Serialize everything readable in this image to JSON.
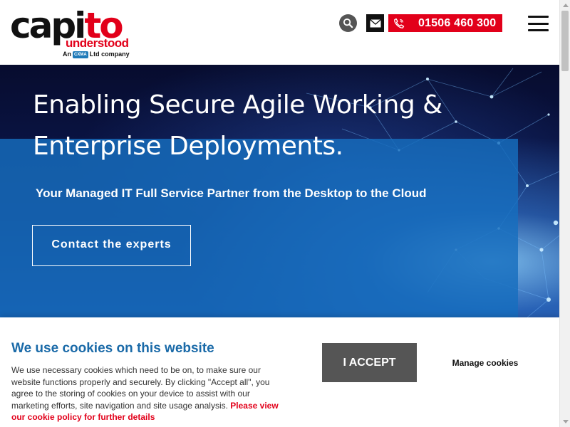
{
  "header": {
    "logo": {
      "main_black": "capi",
      "main_red": "to",
      "sub": "understood",
      "tag_prefix": "An",
      "tag_badge": "CXMA",
      "tag_suffix": "Ltd company"
    },
    "phone": "01506 460 300",
    "icons": {
      "search": "search-icon",
      "mail": "envelope-icon",
      "phone": "phone-icon",
      "menu": "hamburger-menu-icon"
    }
  },
  "hero": {
    "title": "Enabling Secure Agile Working & Enterprise Deployments.",
    "subtitle": "Your Managed IT Full Service Partner from the Desktop to the Cloud",
    "cta": "Contact the experts"
  },
  "cookie": {
    "title": "We use cookies on this website",
    "text": "We use necessary cookies which need to be on, to make sure our website functions properly and securely. By clicking \"Accept all\", you agree to the storing of cookies on your device to assist with our marketing efforts, site navigation and site usage analysis.",
    "policy_link": "Please view our cookie policy for further details",
    "accept": "I ACCEPT",
    "manage": "Manage cookies"
  },
  "colors": {
    "brand_red": "#e2001a",
    "brand_blue": "#1a6aa8",
    "hero_panel": "#166ebe",
    "button_grey": "#555555"
  }
}
